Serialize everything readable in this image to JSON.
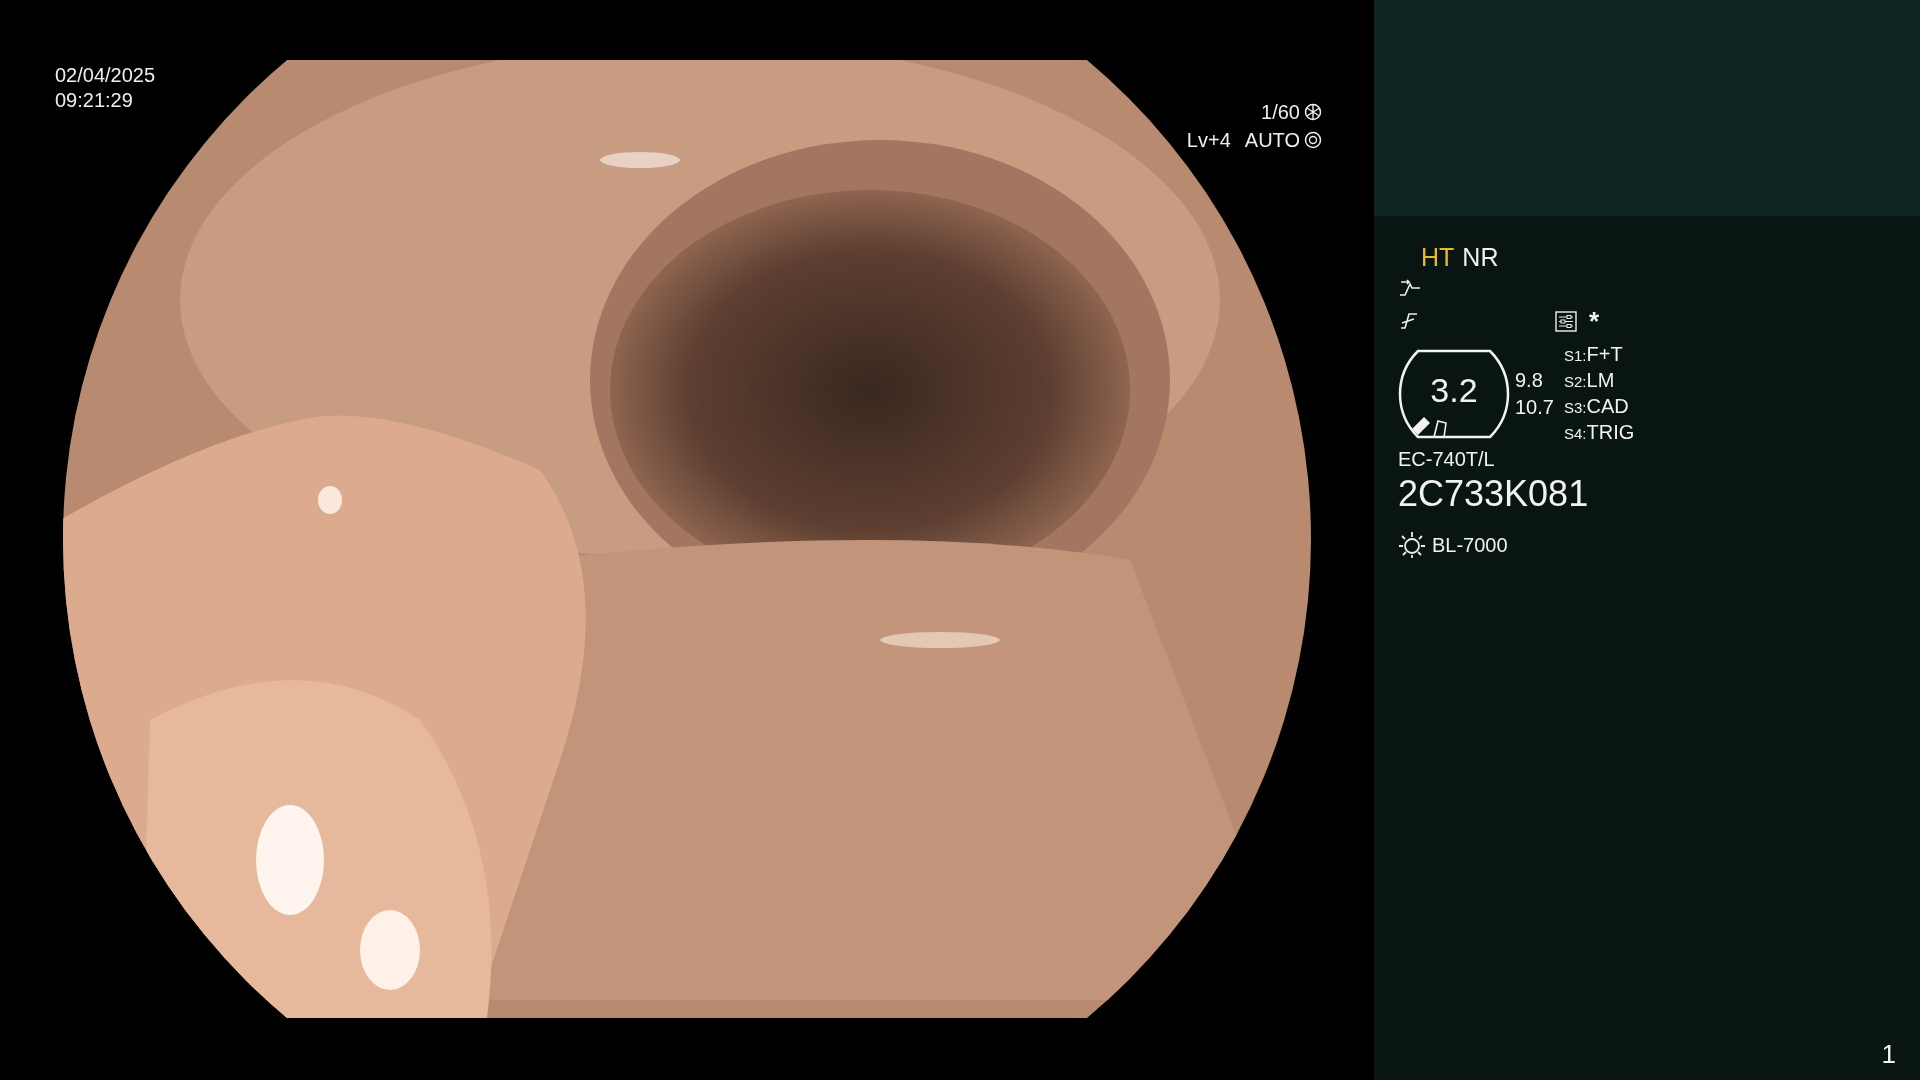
{
  "overlay": {
    "date": "02/04/2025",
    "time": "09:21:29",
    "shutter": "1/60",
    "level": "Lv+4",
    "mode": "AUTO"
  },
  "panel": {
    "modes": [
      {
        "label": "HT",
        "highlighted": true
      },
      {
        "label": "NR",
        "highlighted": false
      }
    ],
    "asterisk": "*",
    "scope": {
      "value": "3.2",
      "readings": [
        "9.8",
        "10.7"
      ]
    },
    "switches": [
      {
        "key": "S1",
        "sep": ":",
        "value": "F+T"
      },
      {
        "key": "S2",
        "sep": ":",
        "value": "LM"
      },
      {
        "key": "S3",
        "sep": ":",
        "value": "CAD"
      },
      {
        "key": "S4",
        "sep": ":",
        "value": "TRIG"
      }
    ],
    "model": "EC-740T/L",
    "serial": "2C733K081",
    "light": "BL-7000"
  },
  "page_number": "1"
}
